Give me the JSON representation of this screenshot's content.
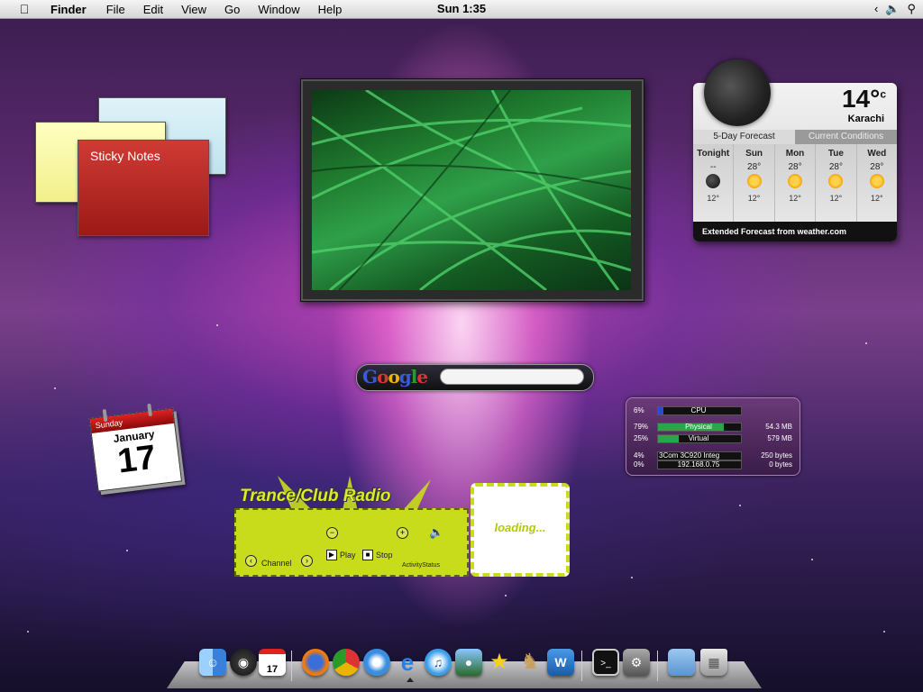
{
  "menubar": {
    "app_name": "Finder",
    "menus": [
      "File",
      "Edit",
      "View",
      "Go",
      "Window",
      "Help"
    ],
    "clock": "Sun 1:35"
  },
  "sticky_notes": {
    "title": "Sticky Notes"
  },
  "weather": {
    "temperature": "14°",
    "unit": "c",
    "city": "Karachi",
    "tabs": [
      "5-Day Forecast",
      "Current Conditions"
    ],
    "days": [
      {
        "name": "Tonight",
        "high": "--",
        "low": "12°",
        "icon": "moon-icon"
      },
      {
        "name": "Sun",
        "high": "28°",
        "low": "12°",
        "icon": "sun-icon"
      },
      {
        "name": "Mon",
        "high": "28°",
        "low": "12°",
        "icon": "sun-icon"
      },
      {
        "name": "Tue",
        "high": "28°",
        "low": "12°",
        "icon": "sun-icon"
      },
      {
        "name": "Wed",
        "high": "28°",
        "low": "12°",
        "icon": "sun-icon"
      }
    ],
    "footer": "Extended Forecast from weather.com"
  },
  "google": {
    "logo": "Google",
    "placeholder": ""
  },
  "calendar": {
    "weekday": "Sunday",
    "month": "January",
    "day": "17"
  },
  "radio": {
    "title": "Trance/Club Radio",
    "loading": "loading...",
    "channel": "Channel",
    "play": "Play",
    "stop": "Stop",
    "activity_status": "ActivityStatus"
  },
  "monitor": {
    "cpu": {
      "percent": "6%",
      "label": "CPU",
      "level": 0.06
    },
    "physical": {
      "percent": "79%",
      "label": "Physical",
      "value": "54.3 MB",
      "level": 0.79
    },
    "virtual": {
      "percent": "25%",
      "label": "Virtual",
      "value": "579 MB",
      "level": 0.25
    },
    "net_in": {
      "percent": "4%",
      "label": "3Com 3C920 Integ",
      "value": "250 bytes"
    },
    "net_out": {
      "percent": "0%",
      "label": "192.168.0.75",
      "value": "0 bytes"
    }
  },
  "colors": {
    "weather_tab_active": "#dadada",
    "radio_lime": "#c9dc1c",
    "monitor_bg": "#5a2e68"
  },
  "dock": {
    "items": [
      "finder-icon",
      "dashboard-icon",
      "ical-icon",
      "firefox-icon",
      "chrome-icon",
      "safari-icon",
      "ie-icon",
      "itunes-icon",
      "iphoto-icon",
      "imovie-icon",
      "chess-icon",
      "word-icon",
      "terminal-icon",
      "system-prefs-icon",
      "folder-icon",
      "trash-icon"
    ],
    "calendar_day": "17"
  }
}
